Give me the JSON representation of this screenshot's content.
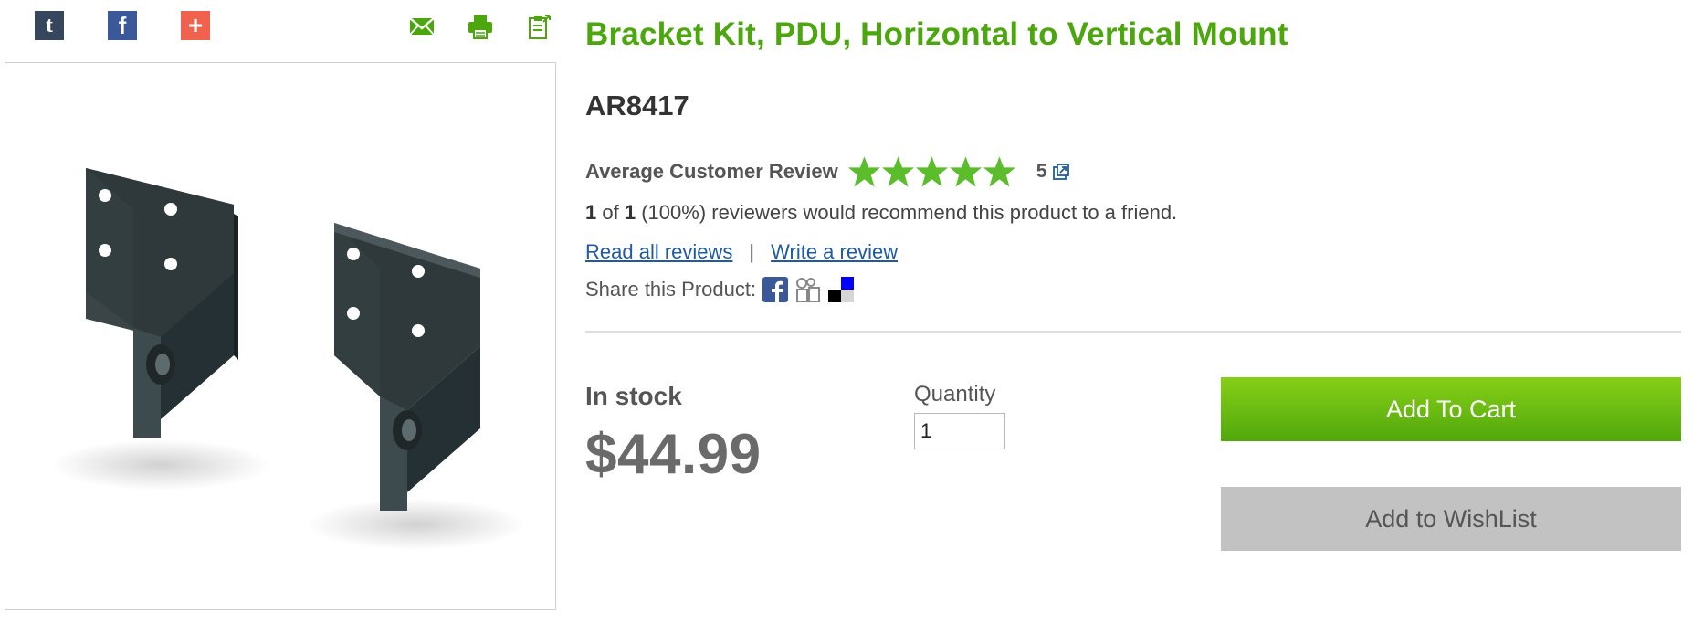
{
  "social": {
    "tumblr_glyph": "t",
    "facebook_glyph": "f",
    "addthis_glyph": "+"
  },
  "colors": {
    "brand_green": "#4ca60d",
    "star_green": "#5bbd2b",
    "link_blue": "#1f5aa3",
    "cart_button": "#6cbf12",
    "wishlist_button": "#c2c2c2"
  },
  "product": {
    "title": "Bracket Kit, PDU, Horizontal to Vertical Mount",
    "sku": "AR8417"
  },
  "reviews": {
    "label": "Average Customer Review",
    "rating": 5,
    "stars_max": 5,
    "rating_text": "5",
    "recommend_count": "1",
    "recommend_of": "of",
    "recommend_total": "1",
    "recommend_text": "(100%) reviewers would recommend this product to a friend.",
    "read_all": "Read all reviews",
    "separator": "|",
    "write": "Write a review"
  },
  "share": {
    "label": "Share this Product:",
    "icons": [
      "facebook-icon",
      "myspace-icon",
      "delicious-icon"
    ]
  },
  "purchase": {
    "stock_status": "In stock",
    "price": "$44.99",
    "quantity_label": "Quantity",
    "quantity_value": "1",
    "add_to_cart": "Add To Cart",
    "add_to_wishlist": "Add to WishList"
  }
}
